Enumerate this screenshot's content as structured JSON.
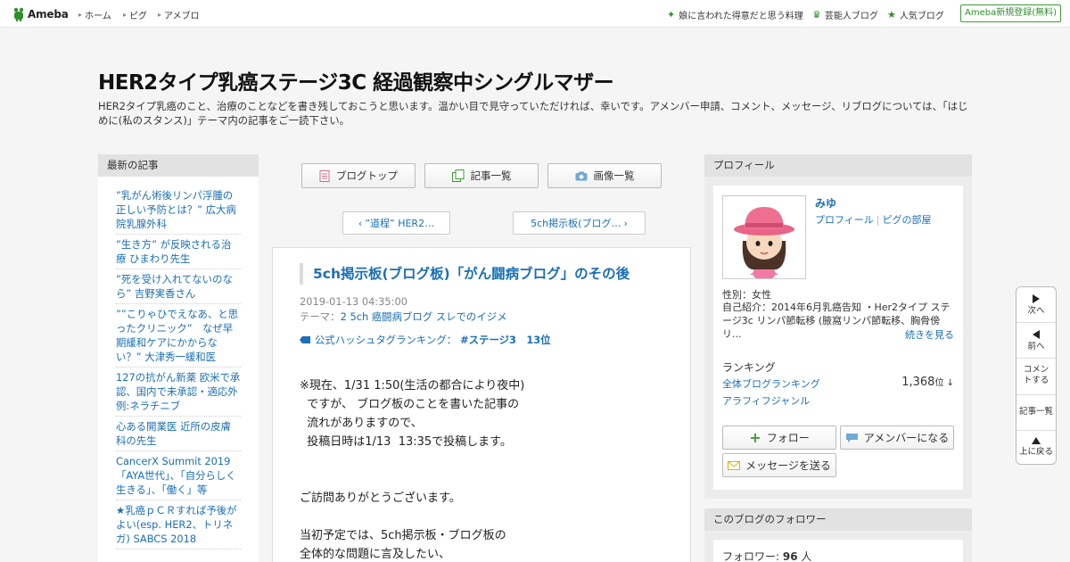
{
  "topbar": {
    "logo_text": "Ameba",
    "nav": [
      "ホーム",
      "ピグ",
      "アメブロ"
    ],
    "right_links": [
      {
        "icon": "sparkle-icon",
        "label": "娘に言われた得意だと思う料理"
      },
      {
        "icon": "crown-icon",
        "label": "芸能人ブログ"
      },
      {
        "icon": "star-icon",
        "label": "人気ブログ"
      }
    ],
    "signup_label": "Ameba新規登録(無料)",
    "accent": "#3f9c35"
  },
  "header": {
    "title": "HER2タイプ乳癌ステージ3C 経過観察中シングルマザー",
    "description": "HER2タイプ乳癌のこと、治療のことなどを書き残しておこうと思います。温かい目で見守っていただければ、幸いです。アメンバー申請、コメント、メッセージ、リブログについては、「はじめに(私のスタンス)」テーマ内の記事をご一読下さい。"
  },
  "left": {
    "heading": "最新の記事",
    "items": [
      "”乳がん術後リンパ浮腫の正しい予防とは？” 広大病院乳腺外科",
      "”生き方” が反映される治療 ひまわり先生",
      "”死を受け入れてないのなら” 吉野実香さん",
      "””こりゃひでえなあ、と思ったクリニック”　なぜ早期緩和ケアにかからない？” 大津秀一緩和医",
      "127の抗がん新薬 欧米で承認、国内で未承認・適応外 例:ネラチニブ",
      "心ある開業医 近所の皮膚科の先生",
      "CancerX Summit 2019 「AYA世代」、「自分らしく生きる」、「働く」等",
      "★乳癌ｐＣＲすれば予後がよい(esp. HER2、トリネガ) SABCS 2018"
    ]
  },
  "center": {
    "nav_buttons": [
      {
        "icon": "document-icon",
        "label": "ブログトップ"
      },
      {
        "icon": "copy-icon",
        "label": "記事一覧"
      },
      {
        "icon": "camera-icon",
        "label": "画像一覧"
      }
    ],
    "prev_label": "”道程” HER2…",
    "next_label": "5ch掲示板(ブログ…",
    "article": {
      "title": "5ch掲示板(ブログ板)「がん闘病ブログ」のその後",
      "date": "2019-01-13 04:35:00",
      "theme_prefix": "テーマ：",
      "theme": "2 5ch 癌闘病ブログ スレでのイジメ",
      "hashtag_prefix": "公式ハッシュタグランキング：",
      "hashtag": "#ステージ3　13位",
      "body": [
        "※現在、1/31 1:50(生活の都合により夜中)",
        "  ですが、 ブログ板のことを書いた記事の",
        "  流れがありますので、",
        "  投稿日時は1/13  13:35で投稿します。",
        "",
        "",
        "ご訪問ありがとうございます。",
        "",
        "当初予定では、5ch掲示板・ブログ板の",
        "全体的な問題に言及したい、"
      ]
    }
  },
  "right": {
    "profile_heading": "プロフィール",
    "name": "みゆ",
    "link_profile": "プロフィール",
    "link_pig": "ピグの部屋",
    "gender": "性別：女性",
    "intro": "自己紹介：2014年6月乳癌告知 ・Her2タイプ ステージ3c リンパ節転移 (腋窩リンパ節転移、胸骨傍リ...",
    "more": "続きを見る",
    "ranking_heading": "ランキング",
    "ranking_all": "全体ブログランキング",
    "ranking_value": "1,368",
    "ranking_unit": "位 ↓",
    "ranking_genre": "アラフィフジャンル",
    "follow_label": "フォロー",
    "amember_label": "アメンバーになる",
    "message_label": "メッセージを送る",
    "followers_heading": "このブログのフォロワー",
    "followers_label": "フォロワー:",
    "followers_count": "96",
    "followers_unit": "人"
  },
  "side_nav": {
    "next": "次へ",
    "prev": "前へ",
    "comment": "コメントする",
    "list": "記事一覧",
    "top": "上に戻る"
  }
}
